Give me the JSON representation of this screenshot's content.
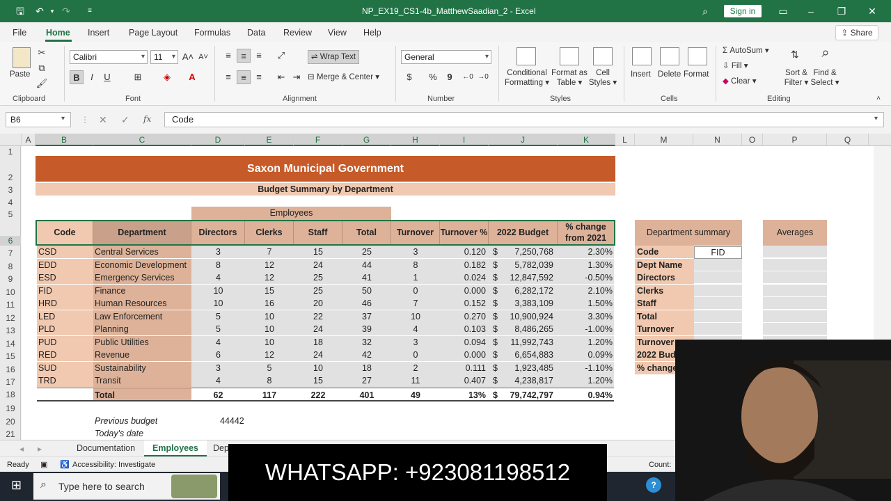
{
  "window": {
    "title": "NP_EX19_CS1-4b_MatthewSaadian_2 - Excel",
    "sign_in": "Sign in"
  },
  "menu": [
    "File",
    "Home",
    "Insert",
    "Page Layout",
    "Formulas",
    "Data",
    "Review",
    "View",
    "Help"
  ],
  "share": "Share",
  "ribbon": {
    "clipboard": {
      "paste": "Paste",
      "label": "Clipboard"
    },
    "font": {
      "name": "Calibri",
      "size": "11",
      "label": "Font",
      "bold": "B",
      "italic": "I",
      "underline": "U"
    },
    "alignment": {
      "wrap": "Wrap Text",
      "merge": "Merge & Center",
      "label": "Alignment"
    },
    "number": {
      "format": "General",
      "currency": "$",
      "percent": "%",
      "comma": "9",
      "label": "Number"
    },
    "styles": {
      "conditional_1": "Conditional",
      "conditional_2": "Formatting",
      "format_table_1": "Format as",
      "format_table_2": "Table",
      "cell_styles_1": "Cell",
      "cell_styles_2": "Styles",
      "label": "Styles"
    },
    "cells": {
      "insert": "Insert",
      "delete": "Delete",
      "format": "Format",
      "label": "Cells"
    },
    "editing": {
      "autosum": "AutoSum",
      "fill": "Fill",
      "clear": "Clear",
      "sort_1": "Sort &",
      "sort_2": "Filter",
      "find_1": "Find &",
      "find_2": "Select",
      "label": "Editing"
    }
  },
  "formula_bar": {
    "name_box": "B6",
    "fx": "fx",
    "content": "Code"
  },
  "columns": [
    "A",
    "B",
    "C",
    "D",
    "E",
    "F",
    "G",
    "H",
    "I",
    "J",
    "K",
    "L",
    "M",
    "N",
    "O",
    "P",
    "Q"
  ],
  "rows": [
    "1",
    "2",
    "3",
    "4",
    "5",
    "6",
    "7",
    "8",
    "9",
    "10",
    "11",
    "12",
    "13",
    "14",
    "15",
    "16",
    "17",
    "18",
    "19",
    "20",
    "21"
  ],
  "sheet": {
    "title": "Saxon Municipal Government",
    "subtitle": "Budget Summary by Department",
    "employees_header": "Employees",
    "headers": [
      "Code",
      "Department",
      "Directors",
      "Clerks",
      "Staff",
      "Total",
      "Turnover",
      "Turnover %",
      "2022 Budget",
      "% change",
      "from 2021"
    ],
    "data": [
      [
        "CSD",
        "Central Services",
        "3",
        "7",
        "15",
        "25",
        "3",
        "0.120",
        "$",
        "7,250,768",
        "2.30%"
      ],
      [
        "EDD",
        "Economic Development",
        "8",
        "12",
        "24",
        "44",
        "8",
        "0.182",
        "$",
        "5,782,039",
        "1.30%"
      ],
      [
        "ESD",
        "Emergency Services",
        "4",
        "12",
        "25",
        "41",
        "1",
        "0.024",
        "$",
        "12,847,592",
        "-0.50%"
      ],
      [
        "FID",
        "Finance",
        "10",
        "15",
        "25",
        "50",
        "0",
        "0.000",
        "$",
        "6,282,172",
        "2.10%"
      ],
      [
        "HRD",
        "Human Resources",
        "10",
        "16",
        "20",
        "46",
        "7",
        "0.152",
        "$",
        "3,383,109",
        "1.50%"
      ],
      [
        "LED",
        "Law Enforcement",
        "5",
        "10",
        "22",
        "37",
        "10",
        "0.270",
        "$",
        "10,900,924",
        "3.30%"
      ],
      [
        "PLD",
        "Planning",
        "5",
        "10",
        "24",
        "39",
        "4",
        "0.103",
        "$",
        "8,486,265",
        "-1.00%"
      ],
      [
        "PUD",
        "Public Utilities",
        "4",
        "10",
        "18",
        "32",
        "3",
        "0.094",
        "$",
        "11,992,743",
        "1.20%"
      ],
      [
        "RED",
        "Revenue",
        "6",
        "12",
        "24",
        "42",
        "0",
        "0.000",
        "$",
        "6,654,883",
        "0.09%"
      ],
      [
        "SUD",
        "Sustainability",
        "3",
        "5",
        "10",
        "18",
        "2",
        "0.111",
        "$",
        "1,923,485",
        "-1.10%"
      ],
      [
        "TRD",
        "Transit",
        "4",
        "8",
        "15",
        "27",
        "11",
        "0.407",
        "$",
        "4,238,817",
        "1.20%"
      ]
    ],
    "total": [
      "",
      "Total",
      "62",
      "117",
      "222",
      "401",
      "49",
      "13%",
      "$",
      "79,742,797",
      "0.94%"
    ],
    "previous_budget_label": "Previous budget",
    "previous_budget_value": "44442",
    "todays_date_label": "Today's date",
    "dept_summary_title": "Department summary",
    "averages_title": "Averages",
    "summary_labels": [
      "Code",
      "Dept Name",
      "Directors",
      "Clerks",
      "Staff",
      "Total",
      "Turnover",
      "Turnover",
      "2022 Budg",
      "% change"
    ],
    "summary_code_value": "FID"
  },
  "tabs": [
    "Documentation",
    "Employees",
    "Dep"
  ],
  "status": {
    "ready": "Ready",
    "accessibility": "Accessibility: Investigate",
    "count": "Count:"
  },
  "taskbar": {
    "search": "Type here to search"
  },
  "overlay": {
    "whatsapp": "WHATSAPP: +923081198512"
  },
  "colors": {
    "excel_green": "#217346",
    "title_orange": "#c65a28",
    "light_orange": "#f0c9b0",
    "tan": "#ddb299"
  }
}
